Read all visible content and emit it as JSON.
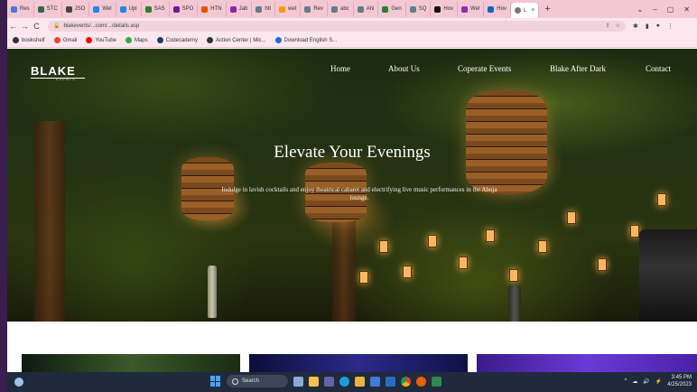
{
  "browser": {
    "tabs": [
      {
        "label": "Res",
        "color": "#4a7bd6"
      },
      {
        "label": "STC",
        "color": "#2f6b3a"
      },
      {
        "label": "JSO",
        "color": "#444444"
      },
      {
        "label": "Wel",
        "color": "#1e88e5"
      },
      {
        "label": "Upl",
        "color": "#1e88e5"
      },
      {
        "label": "SAS",
        "color": "#2e7d32"
      },
      {
        "label": "SPO",
        "color": "#6a1b9a"
      },
      {
        "label": "HTN",
        "color": "#e65100"
      },
      {
        "label": "Jab",
        "color": "#8e24aa"
      },
      {
        "label": "htt",
        "color": "#607d8b"
      },
      {
        "label": "wet",
        "color": "#ff9800"
      },
      {
        "label": "Rev",
        "color": "#607d8b"
      },
      {
        "label": "abc",
        "color": "#607d8b"
      },
      {
        "label": "Ahi",
        "color": "#607d8b"
      },
      {
        "label": "Gen",
        "color": "#2e7d32"
      },
      {
        "label": "SQ",
        "color": "#607d8b"
      },
      {
        "label": "Hov",
        "color": "#111111"
      },
      {
        "label": "Wel",
        "color": "#9c27b0"
      },
      {
        "label": "Hov",
        "color": "#1565c0"
      }
    ],
    "active_tab": {
      "label": "L",
      "close": "×"
    },
    "new_tab": "+",
    "window_controls": [
      "⌄",
      "–",
      "▢",
      "✕"
    ],
    "nav": {
      "back": "←",
      "forward": "→",
      "reload": "C"
    },
    "url": "blakevents/...com/.../details.asp",
    "omnibox_icons": [
      "⇪",
      "☆"
    ],
    "toolbar_icons": [
      "✱",
      "▮",
      "●",
      "⋮"
    ],
    "bookmarks": [
      {
        "label": "bookshelf",
        "color": "#333333"
      },
      {
        "label": "Gmail",
        "color": "#ea4335"
      },
      {
        "label": "YouTube",
        "color": "#ff0000"
      },
      {
        "label": "Maps",
        "color": "#34a853"
      },
      {
        "label": "Codecademy",
        "color": "#1f4056"
      },
      {
        "label": "Action Center | Mic...",
        "color": "#333333"
      },
      {
        "label": "Download English S...",
        "color": "#1e6fd9"
      }
    ]
  },
  "site": {
    "logo": "BLAKE",
    "logo_sub": "EVENTS",
    "nav": [
      "Home",
      "About Us",
      "Coperate Events",
      "Blake After Dark",
      "Contact"
    ],
    "hero_title": "Elevate Your Evenings",
    "hero_text": "Indulge in lavish cocktails and enjoy theatrical cabaret and electrifying live music performances in the Abuja lounge."
  },
  "taskbar": {
    "search": "Search",
    "time": "3:45 PM",
    "date": "4/25/2023",
    "tray_icons": [
      "^",
      "☁",
      "🔊",
      "⚡"
    ]
  }
}
